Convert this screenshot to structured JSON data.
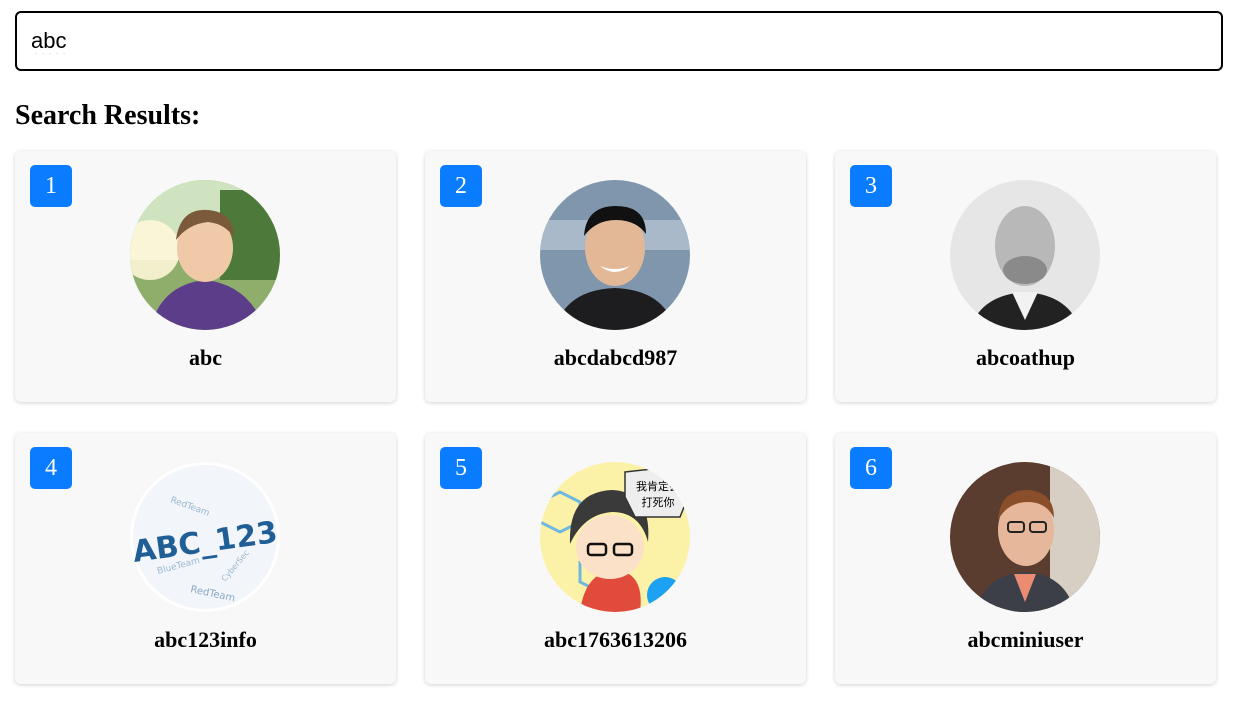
{
  "search": {
    "value": "abc"
  },
  "results_title": "Search Results:",
  "results": [
    {
      "rank": "1",
      "username": "abc",
      "avatar": "person-outdoor-photo"
    },
    {
      "rank": "2",
      "username": "abcdabcd987",
      "avatar": "person-smiling-photo"
    },
    {
      "rank": "3",
      "username": "abcoathup",
      "avatar": "person-grayscale-photo"
    },
    {
      "rank": "4",
      "username": "abc123info",
      "avatar": "word-cloud-logo",
      "avatar_text": "ABC_123"
    },
    {
      "rank": "5",
      "username": "abc1763613206",
      "avatar": "cartoon-avatar",
      "avatar_text": "我肯定会打死你"
    },
    {
      "rank": "6",
      "username": "abcminiuser",
      "avatar": "person-glasses-photo"
    }
  ],
  "colors": {
    "badge": "#0a7cff",
    "card_bg": "#f8f8f8"
  }
}
